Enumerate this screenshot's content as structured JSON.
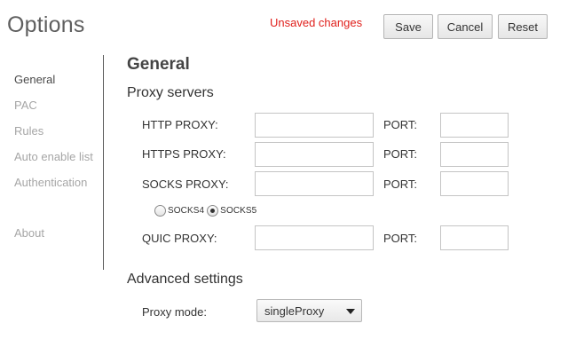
{
  "header": {
    "title": "Options",
    "status": "Unsaved changes",
    "buttons": {
      "save": "Save",
      "cancel": "Cancel",
      "reset": "Reset"
    }
  },
  "sidebar": {
    "items": [
      {
        "label": "General"
      },
      {
        "label": "PAC"
      },
      {
        "label": "Rules"
      },
      {
        "label": "Auto enable list"
      },
      {
        "label": "Authentication"
      },
      {
        "label": "About"
      }
    ]
  },
  "main": {
    "heading": "General",
    "proxy_servers": {
      "heading": "Proxy servers",
      "port_label": "PORT:",
      "http_label": "HTTP PROXY:",
      "https_label": "HTTPS PROXY:",
      "socks_label": "SOCKS PROXY:",
      "quic_label": "QUIC PROXY:",
      "http_value": "",
      "http_port": "",
      "https_value": "",
      "https_port": "",
      "socks_value": "",
      "socks_port": "",
      "quic_value": "",
      "quic_port": "",
      "socks_versions": [
        {
          "label": "SOCKS4",
          "checked": false
        },
        {
          "label": "SOCKS5",
          "checked": true
        }
      ]
    },
    "advanced": {
      "heading": "Advanced settings",
      "proxy_mode_label": "Proxy mode:",
      "proxy_mode_value": "singleProxy"
    }
  }
}
